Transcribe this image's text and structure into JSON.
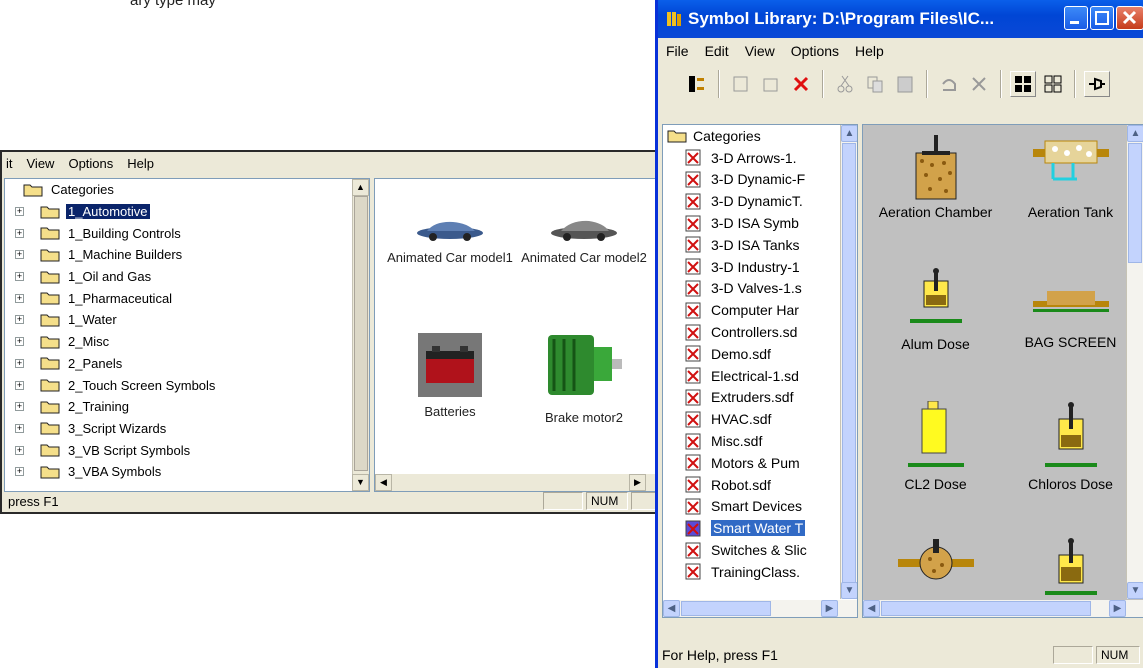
{
  "caption": "ary type may",
  "back_window": {
    "menu": [
      "it",
      "View",
      "Options",
      "Help"
    ],
    "tree_root": "Categories",
    "tree_items": [
      "1_Automotive",
      "1_Building Controls",
      "1_Machine Builders",
      "1_Oil and Gas",
      "1_Pharmaceutical",
      "1_Water",
      "2_Misc",
      "2_Panels",
      "2_Touch Screen Symbols",
      "2_Training",
      "3_Script Wizards",
      "3_VB Script Symbols",
      "3_VBA Symbols"
    ],
    "selected_index": 0,
    "gallery": [
      {
        "label": "Animated Car model1",
        "icon": "blue-car-icon"
      },
      {
        "label": "Animated Car model2",
        "icon": "grey-car-icon"
      },
      {
        "label": "Batteries",
        "icon": "battery-icon"
      },
      {
        "label": "Brake motor2",
        "icon": "motor-icon"
      }
    ],
    "status_text": "press F1",
    "status_num": "NUM"
  },
  "front_window": {
    "title": "Symbol Library: D:\\Program Files\\IC...",
    "menu": [
      "File",
      "Edit",
      "View",
      "Options",
      "Help"
    ],
    "tree_root": "Categories",
    "tree_items": [
      "3-D Arrows-1.",
      "3-D Dynamic-F",
      "3-D DynamicT.",
      "3-D ISA Symb",
      "3-D ISA Tanks",
      "3-D Industry-1",
      "3-D Valves-1.s",
      "Computer Har",
      "Controllers.sd",
      "Demo.sdf",
      "Electrical-1.sd",
      "Extruders.sdf",
      "HVAC.sdf",
      "Misc.sdf",
      "Motors & Pum",
      "Robot.sdf",
      "Smart Devices",
      "Smart Water T",
      "Switches & Slic",
      "TrainingClass."
    ],
    "selected_index": 17,
    "gallery": [
      {
        "label": "Aeration Chamber",
        "icon": "aeration-chamber-icon"
      },
      {
        "label": "Aeration Tank",
        "icon": "aeration-tank-icon"
      },
      {
        "label": "Alum Dose",
        "icon": "alum-dose-icon"
      },
      {
        "label": "BAG SCREEN",
        "icon": "bag-screen-icon"
      },
      {
        "label": "CL2 Dose",
        "icon": "cl2-dose-icon"
      },
      {
        "label": "Chloros Dose",
        "icon": "chloros-dose-icon"
      },
      {
        "label": "",
        "icon": "valve-icon"
      },
      {
        "label": "",
        "icon": "mixer-tank-icon"
      }
    ],
    "status_text": "For Help, press F1",
    "status_num": "NUM",
    "colors": {
      "titlebar": "#0a5fea",
      "selection": "#316ac5",
      "gallery_bg": "#c0c0c0"
    }
  }
}
